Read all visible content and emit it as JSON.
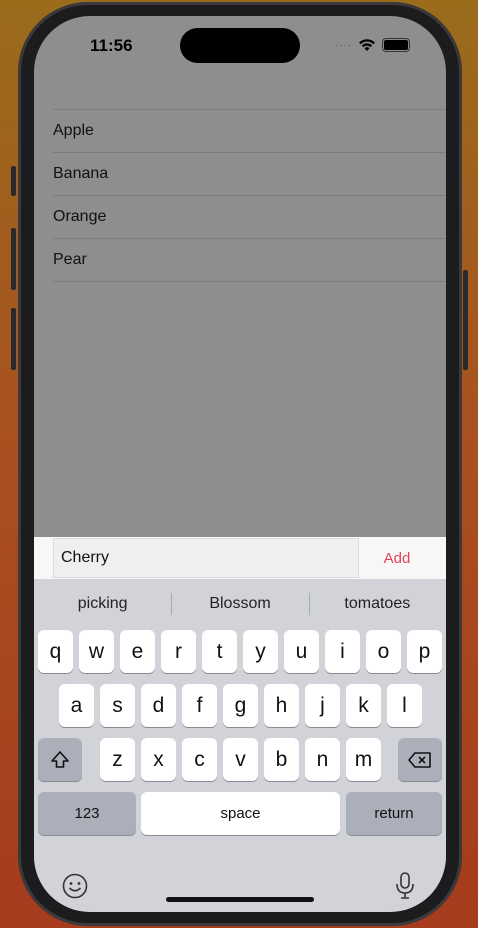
{
  "status": {
    "time": "11:56",
    "signal_dots": "····"
  },
  "list": {
    "items": [
      "Apple",
      "Banana",
      "Orange",
      "Pear"
    ]
  },
  "input": {
    "value": "Cherry",
    "add_label": "Add"
  },
  "keyboard": {
    "suggestions": [
      "picking",
      "Blossom",
      "tomatoes"
    ],
    "row1": [
      "q",
      "w",
      "e",
      "r",
      "t",
      "y",
      "u",
      "i",
      "o",
      "p"
    ],
    "row2": [
      "a",
      "s",
      "d",
      "f",
      "g",
      "h",
      "j",
      "k",
      "l"
    ],
    "row3": [
      "z",
      "x",
      "c",
      "v",
      "b",
      "n",
      "m"
    ],
    "numbers_label": "123",
    "space_label": "space",
    "return_label": "return"
  },
  "colors": {
    "accent": "#e0455b",
    "dimmed_background": "#8e8e90",
    "keyboard_bg": "#d1d3d9"
  }
}
